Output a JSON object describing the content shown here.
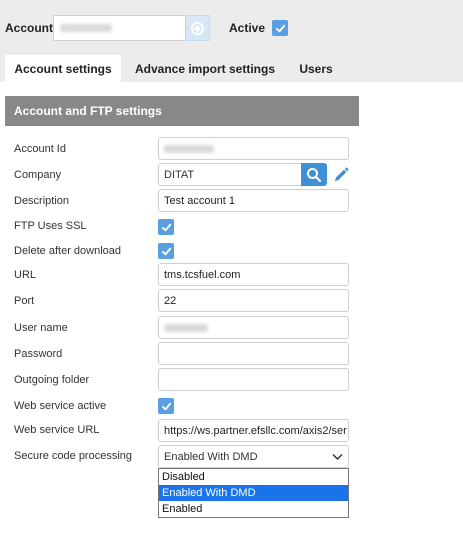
{
  "header": {
    "account_label": "Account",
    "active_label": "Active",
    "active_checked": true
  },
  "tabs": [
    {
      "label": "Account settings",
      "active": true
    },
    {
      "label": "Advance import settings",
      "active": false
    },
    {
      "label": "Users",
      "active": false
    }
  ],
  "section": {
    "title": "Account and FTP settings"
  },
  "form": {
    "account_id": {
      "label": "Account Id"
    },
    "company": {
      "label": "Company",
      "value": "DITAT"
    },
    "description": {
      "label": "Description",
      "value": "Test account 1"
    },
    "ftp_ssl": {
      "label": "FTP Uses SSL",
      "checked": true
    },
    "delete_after": {
      "label": "Delete after download",
      "checked": true
    },
    "url": {
      "label": "URL",
      "value": "tms.tcsfuel.com"
    },
    "port": {
      "label": "Port",
      "value": "22"
    },
    "user_name": {
      "label": "User name"
    },
    "password": {
      "label": "Password",
      "value": ""
    },
    "outgoing_folder": {
      "label": "Outgoing folder",
      "value": ""
    },
    "web_service_active": {
      "label": "Web service active",
      "checked": true
    },
    "web_service_url": {
      "label": "Web service URL",
      "value": "https://ws.partner.efsllc.com/axis2/ser"
    },
    "secure_code": {
      "label": "Secure code processing",
      "selected": "Enabled With DMD",
      "options": [
        "Disabled",
        "Enabled With DMD",
        "Enabled"
      ]
    }
  },
  "icons": {
    "account_lookup": "compass-icon",
    "search": "search-icon",
    "edit": "pencil-icon",
    "dropdown": "chevron-down-icon",
    "check": "check-icon"
  },
  "colors": {
    "accent": "#5a9fdf",
    "search_button": "#3d8fd6",
    "section_header": "#888888",
    "selected_option": "#1a73e8"
  }
}
